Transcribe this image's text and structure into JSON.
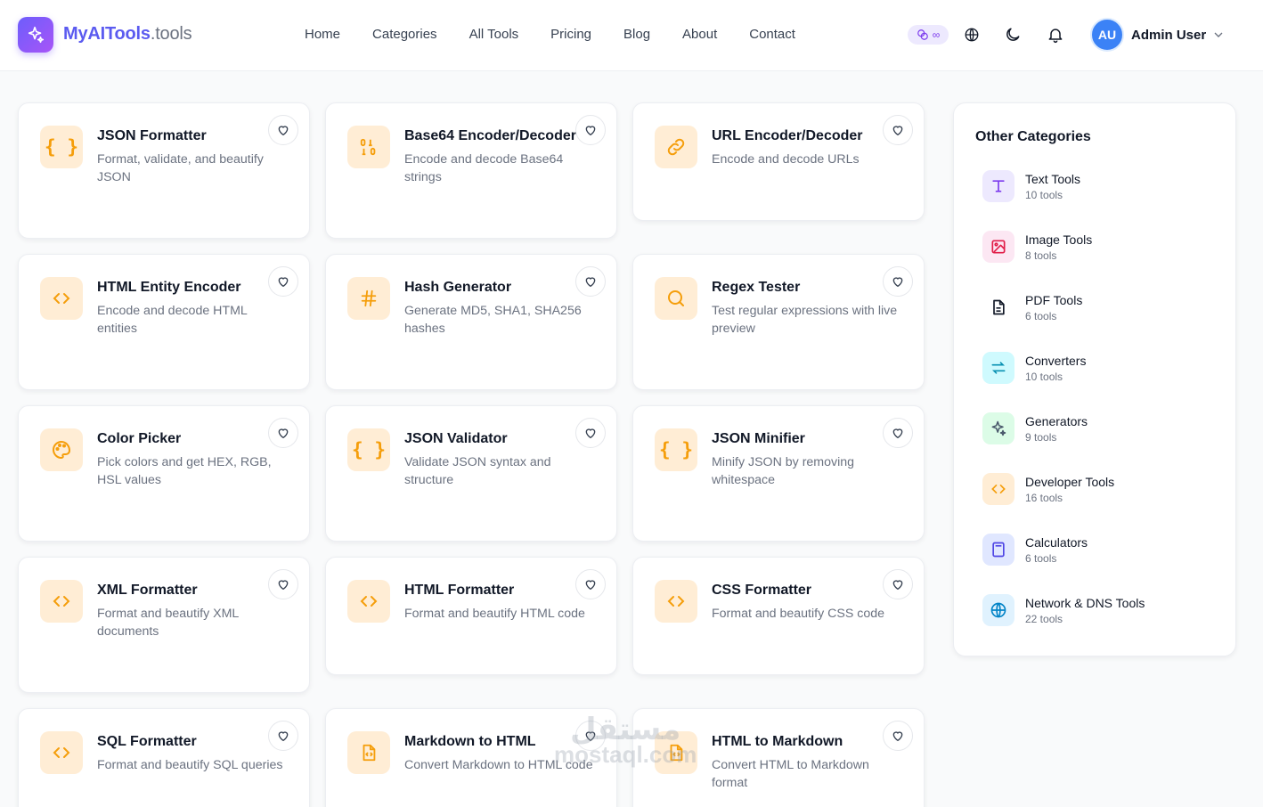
{
  "brand": {
    "name": "MyAITools",
    "suffix": ".tools"
  },
  "nav": [
    "Home",
    "Categories",
    "All Tools",
    "Pricing",
    "Blog",
    "About",
    "Contact"
  ],
  "header": {
    "credits": "∞",
    "user_initials": "AU",
    "user_name": "Admin User"
  },
  "colors": {
    "accent": "#5b5bf0",
    "icon_orange": "#f59e0b",
    "icon_bg": "#ffedd5"
  },
  "tools": [
    {
      "title": "JSON Formatter",
      "desc": "Format, validate, and beautify JSON",
      "icon": "braces-icon"
    },
    {
      "title": "Base64 Encoder/Decoder",
      "desc": "Encode and decode Base64 strings",
      "icon": "binary-icon"
    },
    {
      "title": "URL Encoder/Decoder",
      "desc": "Encode and decode URLs",
      "icon": "link-icon"
    },
    {
      "title": "HTML Entity Encoder",
      "desc": "Encode and decode HTML entities",
      "icon": "code-icon"
    },
    {
      "title": "Hash Generator",
      "desc": "Generate MD5, SHA1, SHA256 hashes",
      "icon": "hash-icon"
    },
    {
      "title": "Regex Tester",
      "desc": "Test regular expressions with live preview",
      "icon": "search-icon"
    },
    {
      "title": "Color Picker",
      "desc": "Pick colors and get HEX, RGB, HSL values",
      "icon": "palette-icon"
    },
    {
      "title": "JSON Validator",
      "desc": "Validate JSON syntax and structure",
      "icon": "braces-icon"
    },
    {
      "title": "JSON Minifier",
      "desc": "Minify JSON by removing whitespace",
      "icon": "braces-icon"
    },
    {
      "title": "XML Formatter",
      "desc": "Format and beautify XML documents",
      "icon": "code-icon"
    },
    {
      "title": "HTML Formatter",
      "desc": "Format and beautify HTML code",
      "icon": "code-icon"
    },
    {
      "title": "CSS Formatter",
      "desc": "Format and beautify CSS code",
      "icon": "code-icon"
    },
    {
      "title": "SQL Formatter",
      "desc": "Format and beautify SQL queries",
      "icon": "code-icon"
    },
    {
      "title": "Markdown to HTML",
      "desc": "Convert Markdown to HTML code",
      "icon": "file-code-icon"
    },
    {
      "title": "HTML to Markdown",
      "desc": "Convert HTML to Markdown format",
      "icon": "file-code-icon"
    }
  ],
  "sidebar": {
    "title": "Other Categories",
    "categories": [
      {
        "name": "Text Tools",
        "count": "10 tools",
        "icon": "text-icon",
        "bg": "#ede9fe",
        "fg": "#7c3aed"
      },
      {
        "name": "Image Tools",
        "count": "8 tools",
        "icon": "image-icon",
        "bg": "#fce7f3",
        "fg": "#e11d48"
      },
      {
        "name": "PDF Tools",
        "count": "6 tools",
        "icon": "file-icon",
        "bg": "#ffffff",
        "fg": "#111827"
      },
      {
        "name": "Converters",
        "count": "10 tools",
        "icon": "arrows-icon",
        "bg": "#cffafe",
        "fg": "#0891b2"
      },
      {
        "name": "Generators",
        "count": "9 tools",
        "icon": "sparkles-icon",
        "bg": "#dcfce7",
        "fg": "#475569"
      },
      {
        "name": "Developer Tools",
        "count": "16 tools",
        "icon": "code-icon",
        "bg": "#ffedd5",
        "fg": "#f59e0b"
      },
      {
        "name": "Calculators",
        "count": "6 tools",
        "icon": "calculator-icon",
        "bg": "#e0e7ff",
        "fg": "#4f46e5"
      },
      {
        "name": "Network & DNS Tools",
        "count": "22 tools",
        "icon": "globe-icon",
        "bg": "#e0f2fe",
        "fg": "#0284c7"
      }
    ]
  },
  "watermark": {
    "line1": "مستقل",
    "line2": "mostaql.com"
  }
}
